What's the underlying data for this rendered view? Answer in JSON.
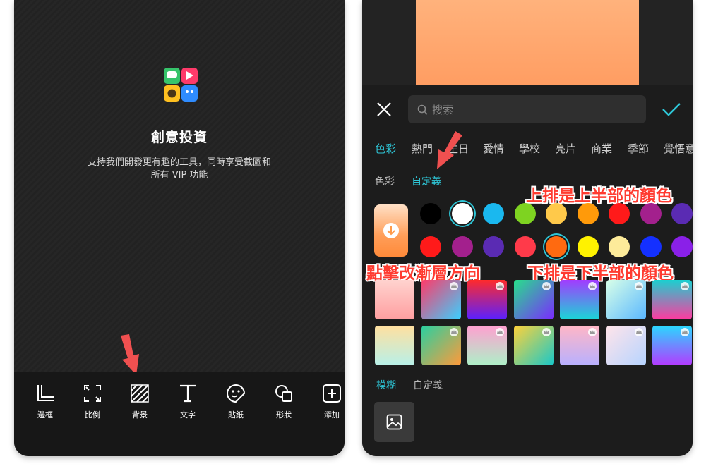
{
  "left_panel": {
    "promo_title": "創意投資",
    "promo_desc_line1": "支持我們開發更有趣的工具，同時享受截圖和",
    "promo_desc_line2": "所有 VIP 功能",
    "toolbar": [
      {
        "label": "邊框",
        "icon": "frame-icon"
      },
      {
        "label": "比例",
        "icon": "ratio-icon"
      },
      {
        "label": "背景",
        "icon": "background-icon"
      },
      {
        "label": "文字",
        "icon": "text-icon"
      },
      {
        "label": "貼紙",
        "icon": "sticker-icon"
      },
      {
        "label": "形狀",
        "icon": "shape-icon"
      },
      {
        "label": "添加",
        "icon": "add-icon"
      }
    ]
  },
  "right_panel": {
    "search_placeholder": "搜索",
    "categories": [
      "色彩",
      "熱門",
      "生日",
      "愛情",
      "學校",
      "亮片",
      "商業",
      "季節",
      "覺悟意"
    ],
    "active_category": "色彩",
    "subtabs": [
      "色彩",
      "自定義"
    ],
    "active_subtab": "自定義",
    "top_row_colors": [
      "#000000",
      "#ffffff",
      "#1ab8ef",
      "#7ed321",
      "#ffc94a",
      "#ff9a0a",
      "#ff1a1a",
      "#a3208d",
      "#5a2bb3"
    ],
    "bottom_row_colors": [
      "#ff1a1a",
      "#a3208d",
      "#5a2bb3",
      "#ff3a4a",
      "#ff6a10",
      "#fff200",
      "#fdeb9a",
      "#1430ff",
      "#8a20e8"
    ],
    "gradient_row1": [
      {
        "from": "#ffd3cf",
        "to": "#ff9fa0",
        "premium": false
      },
      {
        "from": "#ff3b6a",
        "to": "#3ad0ff",
        "premium": true
      },
      {
        "from": "#ff2a2a",
        "to": "#5a20ff",
        "premium": true
      },
      {
        "from": "#27e08a",
        "to": "#7a2bff",
        "premium": true
      },
      {
        "from": "#a23bff",
        "to": "#1ad6d6",
        "premium": true
      },
      {
        "from": "#d8ffe8",
        "to": "#5ab8ff",
        "premium": true
      },
      {
        "from": "#1ad0d0",
        "to": "#ff3aa0",
        "premium": true
      }
    ],
    "gradient_row2": [
      {
        "from": "#ffe0a0",
        "to": "#b8f0e8",
        "premium": false
      },
      {
        "from": "#2ad0a0",
        "to": "#ff9a3a",
        "premium": true
      },
      {
        "from": "#ffa0d0",
        "to": "#aef0c8",
        "premium": true
      },
      {
        "from": "#ffd23a",
        "to": "#1ac8c8",
        "premium": true
      },
      {
        "from": "#ffb6c6",
        "to": "#b8b0ff",
        "premium": true
      },
      {
        "from": "#ffe4ea",
        "to": "#b6d4ff",
        "premium": true
      },
      {
        "from": "#2ad8ff",
        "to": "#b43aff",
        "premium": true
      }
    ],
    "blur_tabs": [
      "模糊",
      "自定義"
    ],
    "active_blur_tab": "模糊"
  },
  "annotations": {
    "top_row_note": "上排是上半部的顏色",
    "bottom_row_note": "下排是下半部的顏色",
    "direction_note": "點擊改漸層方向"
  },
  "colors": {
    "accent": "#2ec7d8",
    "annotation_red": "#ff3b30",
    "arrow": "#f05050"
  }
}
